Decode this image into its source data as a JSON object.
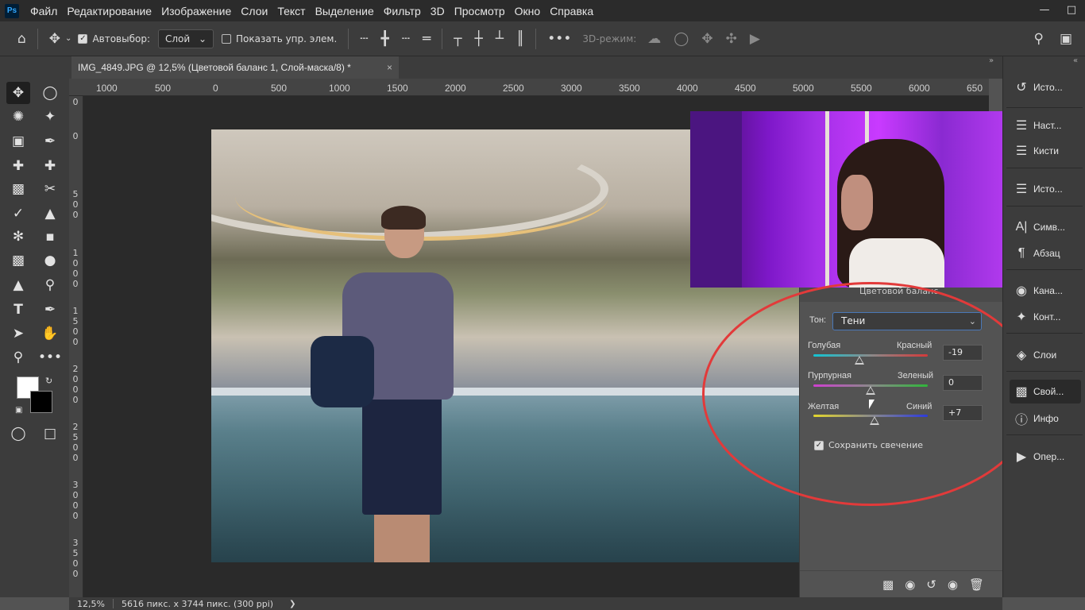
{
  "app": {
    "logo": "Ps"
  },
  "menu": [
    "Файл",
    "Редактирование",
    "Изображение",
    "Слои",
    "Текст",
    "Выделение",
    "Фильтр",
    "3D",
    "Просмотр",
    "Окно",
    "Справка"
  ],
  "options": {
    "autoselect_label": "Автовыбор:",
    "autoselect_value": "Слой",
    "show_transform_label": "Показать упр. элем.",
    "mode3d_label": "3D-режим:"
  },
  "document": {
    "tab_title": "IMG_4849.JPG @ 12,5% (Цветовой баланс 1, Слой-маска/8) *",
    "tab_close": "×"
  },
  "ruler_top": [
    "1000",
    "500",
    "0",
    "500",
    "1000",
    "1500",
    "2000",
    "2500",
    "3000",
    "3500",
    "4000",
    "4500",
    "5000",
    "5500",
    "6000",
    "650"
  ],
  "ruler_left": [
    "0",
    "0",
    "5",
    "0",
    "0",
    "1",
    "0",
    "0",
    "0",
    "1",
    "5",
    "0",
    "0",
    "2",
    "0",
    "0",
    "0",
    "2",
    "5",
    "0",
    "0",
    "3",
    "0",
    "0",
    "0",
    "3",
    "5",
    "0",
    "0"
  ],
  "properties": {
    "header": "Цветовой баланс",
    "tone_label": "Тон:",
    "tone_value": "Тени",
    "sliders": [
      {
        "left": "Голубая",
        "right": "Красный",
        "value": "-19",
        "level": -19,
        "colors": [
          "#12c4d3",
          "#d43a3a"
        ]
      },
      {
        "left": "Пурпурная",
        "right": "Зеленый",
        "value": "0",
        "level": 0,
        "colors": [
          "#cf3fd0",
          "#2fb53a"
        ]
      },
      {
        "left": "Желтая",
        "right": "Синий",
        "value": "+7",
        "level": 7,
        "colors": [
          "#e3d62d",
          "#2d3bdc"
        ]
      }
    ],
    "preserve_label": "Сохранить свечение",
    "preserve_checked": true
  },
  "dock": [
    {
      "label": "Исто...",
      "icon": "history-icon"
    },
    {
      "label": "Наст...",
      "icon": "adjustments-icon"
    },
    {
      "label": "Кисти",
      "icon": "brushes-icon"
    },
    {
      "label": "Исто...",
      "icon": "clone-source-icon"
    },
    {
      "label": "Симв...",
      "icon": "character-icon"
    },
    {
      "label": "Абзац",
      "icon": "paragraph-icon"
    },
    {
      "label": "Кана...",
      "icon": "channels-icon"
    },
    {
      "label": "Конт...",
      "icon": "paths-icon"
    },
    {
      "label": "Слои",
      "icon": "layers-icon"
    },
    {
      "label": "Свой...",
      "icon": "properties-icon"
    },
    {
      "label": "Инфо",
      "icon": "info-icon"
    },
    {
      "label": "Опер...",
      "icon": "actions-icon"
    }
  ],
  "status": {
    "zoom": "12,5%",
    "doc_info": "5616 пикс. x 3744 пикс. (300 ppi)",
    "arrow": "❯"
  },
  "colors": {
    "accent": "#4a78b7",
    "annotation": "#e23a3a"
  }
}
